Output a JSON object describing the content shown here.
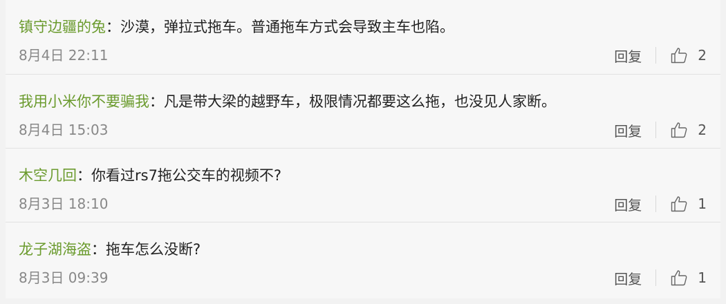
{
  "comments": [
    {
      "user": "镇守边疆的兔",
      "separator": "：",
      "text": "沙漠，弹拉式拖车。普通拖车方式会导致主车也陷。",
      "time": "8月4日 22:11",
      "reply_label": "回复",
      "likes": "2"
    },
    {
      "user": "我用小米你不要骗我",
      "separator": "：",
      "text": "凡是带大梁的越野车，极限情况都要这么拖，也没见人家断。",
      "time": "8月4日 15:03",
      "reply_label": "回复",
      "likes": "2"
    },
    {
      "user": "木空几回",
      "separator": "：",
      "text": "你看过rs7拖公交车的视频不?",
      "time": "8月3日 18:10",
      "reply_label": "回复",
      "likes": "1"
    },
    {
      "user": "龙子湖海盗",
      "separator": "：",
      "text": "拖车怎么没断?",
      "time": "8月3日 09:39",
      "reply_label": "回复",
      "likes": "1"
    }
  ],
  "colors": {
    "username": "#6b9b2e",
    "text": "#222222",
    "meta": "#888888",
    "action": "#555555"
  },
  "icons": {
    "like": "thumbs-up-icon"
  }
}
